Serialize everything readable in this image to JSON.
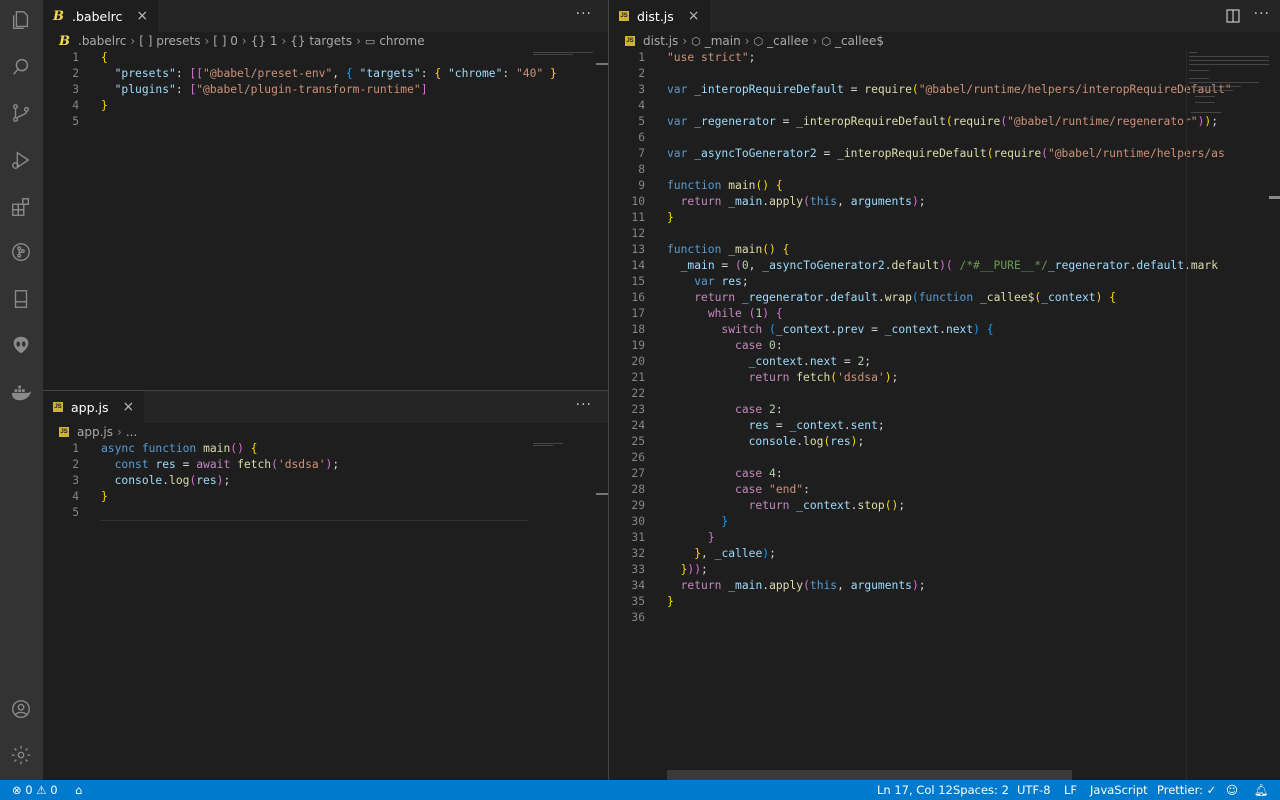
{
  "activity_bar": {
    "icons": [
      "explorer-icon",
      "search-icon",
      "source-control-icon",
      "run-debug-icon",
      "extensions-icon",
      "git-graph-icon",
      "remote-explorer-icon",
      "alien-icon",
      "docker-icon",
      "account-icon",
      "settings-gear-icon"
    ]
  },
  "left_top": {
    "tab": {
      "label": ".babelrc",
      "close": "×"
    },
    "more": "···",
    "breadcrumb": [
      ".babelrc",
      "[ ] presets",
      "[ ] 0",
      "{} 1",
      "{} targets",
      "chrome"
    ],
    "lines": [
      {
        "n": "1",
        "html": "<span class='tok-br'>{</span>"
      },
      {
        "n": "2",
        "html": "  <span class='tok-key'>\"presets\"</span>: <span class='tok-br2'>[[</span><span class='tok-str'>\"@babel/preset-env\"</span>, <span class='tok-br3'>{</span> <span class='tok-key'>\"targets\"</span>: <span class='tok-br'>{</span> <span class='tok-key'>\"chrome\"</span>: <span class='tok-str'>\"40\"</span> <span class='tok-br'>}</span>"
      },
      {
        "n": "3",
        "html": "  <span class='tok-key'>\"plugins\"</span>: <span class='tok-br2'>[</span><span class='tok-str'>\"@babel/plugin-transform-runtime\"</span><span class='tok-br2'>]</span>"
      },
      {
        "n": "4",
        "html": "<span class='tok-br'>}</span>"
      },
      {
        "n": "5",
        "html": ""
      }
    ]
  },
  "left_bottom": {
    "tab": {
      "label": "app.js",
      "close": "×"
    },
    "more": "···",
    "breadcrumb": [
      "app.js",
      "..."
    ],
    "lines": [
      {
        "n": "1",
        "html": "<span class='tok-kw'>async</span> <span class='tok-kw'>function</span> <span class='tok-fn'>main</span><span class='tok-br2'>()</span> <span class='tok-br'>{</span>"
      },
      {
        "n": "2",
        "html": "  <span class='tok-kw'>const</span> <span class='tok-key'>res</span> = <span class='tok-ctl'>await</span> <span class='tok-fn'>fetch</span><span class='tok-br2'>(</span><span class='tok-str'>'dsdsa'</span><span class='tok-br2'>)</span>;"
      },
      {
        "n": "3",
        "html": "  <span class='tok-key'>console</span>.<span class='tok-fn'>log</span><span class='tok-br2'>(</span><span class='tok-key'>res</span><span class='tok-br2'>)</span>;"
      },
      {
        "n": "4",
        "html": "<span class='tok-br'>}</span>"
      },
      {
        "n": "5",
        "html": ""
      }
    ]
  },
  "right": {
    "tab": {
      "label": "dist.js",
      "close": "×"
    },
    "breadcrumb": [
      "dist.js",
      "_main",
      "_callee",
      "_callee$"
    ],
    "lines": [
      {
        "n": "1",
        "html": "<span class='tok-str'>\"use strict\"</span>;"
      },
      {
        "n": "2",
        "html": ""
      },
      {
        "n": "3",
        "html": "<span class='tok-kw'>var</span> <span class='tok-key'>_interopRequireDefault</span> = <span class='tok-fn'>require</span><span class='tok-br'>(</span><span class='tok-str'>\"@babel/runtime/helpers/interopRequireDefault\"</span>"
      },
      {
        "n": "4",
        "html": ""
      },
      {
        "n": "5",
        "html": "<span class='tok-kw'>var</span> <span class='tok-key'>_regenerator</span> = <span class='tok-fn'>_interopRequireDefault</span><span class='tok-br'>(</span><span class='tok-fn'>require</span><span class='tok-br2'>(</span><span class='tok-str'>\"@babel/runtime/regenerator\"</span><span class='tok-br2'>)</span><span class='tok-br'>)</span>;"
      },
      {
        "n": "6",
        "html": ""
      },
      {
        "n": "7",
        "html": "<span class='tok-kw'>var</span> <span class='tok-key'>_asyncToGenerator2</span> = <span class='tok-fn'>_interopRequireDefault</span><span class='tok-br'>(</span><span class='tok-fn'>require</span><span class='tok-br2'>(</span><span class='tok-str'>\"@babel/runtime/helpers/as</span>"
      },
      {
        "n": "8",
        "html": ""
      },
      {
        "n": "9",
        "html": "<span class='tok-kw'>function</span> <span class='tok-fn'>main</span><span class='tok-br'>()</span> <span class='tok-br'>{</span>"
      },
      {
        "n": "10",
        "html": "  <span class='tok-ctl'>return</span> <span class='tok-key'>_main</span>.<span class='tok-fn'>apply</span><span class='tok-br2'>(</span><span class='tok-kw'>this</span>, <span class='tok-key'>arguments</span><span class='tok-br2'>)</span>;"
      },
      {
        "n": "11",
        "html": "<span class='tok-br'>}</span>"
      },
      {
        "n": "12",
        "html": ""
      },
      {
        "n": "13",
        "html": "<span class='tok-kw'>function</span> <span class='tok-fn'>_main</span><span class='tok-br'>()</span> <span class='tok-br'>{</span>"
      },
      {
        "n": "14",
        "html": "  <span class='tok-key'>_main</span> = <span class='tok-br2'>(</span><span class='tok-num'>0</span>, <span class='tok-key'>_asyncToGenerator2</span>.<span class='tok-fn'>default</span><span class='tok-br2'>)(</span> <span class='tok-cm'>/*#__PURE__*/</span><span class='tok-key'>_regenerator</span>.<span class='tok-key'>default</span>.<span class='tok-fn'>mark</span>"
      },
      {
        "n": "15",
        "html": "    <span class='tok-kw'>var</span> <span class='tok-key'>res</span>;"
      },
      {
        "n": "16",
        "html": "    <span class='tok-ctl'>return</span> <span class='tok-key'>_regenerator</span>.<span class='tok-key'>default</span>.<span class='tok-fn'>wrap</span><span class='tok-br3'>(</span><span class='tok-kw'>function</span> <span class='tok-fn'>_callee$</span><span class='tok-br'>(</span><span class='tok-key'>_context</span><span class='tok-br'>)</span> <span class='tok-br'>{</span>"
      },
      {
        "n": "17",
        "html": "      <span class='tok-ctl'>while</span> <span class='tok-br2'>(</span><span class='tok-num'>1</span><span class='tok-br2'>)</span> <span class='tok-br2'>{</span>"
      },
      {
        "n": "18",
        "html": "        <span class='tok-ctl'>switch</span> <span class='tok-br3'>(</span><span class='tok-key'>_context</span>.<span class='tok-key'>prev</span> = <span class='tok-key'>_context</span>.<span class='tok-key'>next</span><span class='tok-br3'>)</span> <span class='tok-br3'>{</span>"
      },
      {
        "n": "19",
        "html": "          <span class='tok-ctl'>case</span> <span class='tok-num'>0</span>:"
      },
      {
        "n": "20",
        "html": "            <span class='tok-key'>_context</span>.<span class='tok-key'>next</span> = <span class='tok-num'>2</span>;"
      },
      {
        "n": "21",
        "html": "            <span class='tok-ctl'>return</span> <span class='tok-fn'>fetch</span><span class='tok-br'>(</span><span class='tok-str'>'dsdsa'</span><span class='tok-br'>)</span>;"
      },
      {
        "n": "22",
        "html": ""
      },
      {
        "n": "23",
        "html": "          <span class='tok-ctl'>case</span> <span class='tok-num'>2</span>:"
      },
      {
        "n": "24",
        "html": "            <span class='tok-key'>res</span> = <span class='tok-key'>_context</span>.<span class='tok-key'>sent</span>;"
      },
      {
        "n": "25",
        "html": "            <span class='tok-key'>console</span>.<span class='tok-fn'>log</span><span class='tok-br'>(</span><span class='tok-key'>res</span><span class='tok-br'>)</span>;"
      },
      {
        "n": "26",
        "html": ""
      },
      {
        "n": "27",
        "html": "          <span class='tok-ctl'>case</span> <span class='tok-num'>4</span>:"
      },
      {
        "n": "28",
        "html": "          <span class='tok-ctl'>case</span> <span class='tok-str'>\"end\"</span>:"
      },
      {
        "n": "29",
        "html": "            <span class='tok-ctl'>return</span> <span class='tok-key'>_context</span>.<span class='tok-fn'>stop</span><span class='tok-br'>()</span>;"
      },
      {
        "n": "30",
        "html": "        <span class='tok-br3'>}</span>"
      },
      {
        "n": "31",
        "html": "      <span class='tok-br2'>}</span>"
      },
      {
        "n": "32",
        "html": "    <span class='tok-br'>}</span>, <span class='tok-key'>_callee</span><span class='tok-br3'>)</span>;"
      },
      {
        "n": "33",
        "html": "  <span class='tok-br'>}</span><span class='tok-br2'>))</span>;"
      },
      {
        "n": "34",
        "html": "  <span class='tok-ctl'>return</span> <span class='tok-key'>_main</span>.<span class='tok-fn'>apply</span><span class='tok-br2'>(</span><span class='tok-kw'>this</span>, <span class='tok-key'>arguments</span><span class='tok-br2'>)</span>;"
      },
      {
        "n": "35",
        "html": "<span class='tok-br'>}</span>"
      },
      {
        "n": "36",
        "html": ""
      }
    ]
  },
  "status": {
    "errors": "0",
    "warnings": "0",
    "position": "Ln 17, Col 12",
    "spaces": "Spaces: 2",
    "encoding": "UTF-8",
    "eol": "LF",
    "language": "JavaScript",
    "prettier": "Prettier: ✓"
  },
  "colors": {
    "statusbar": "#007acc",
    "activity": "#333333",
    "editor": "#1e1e1e"
  }
}
